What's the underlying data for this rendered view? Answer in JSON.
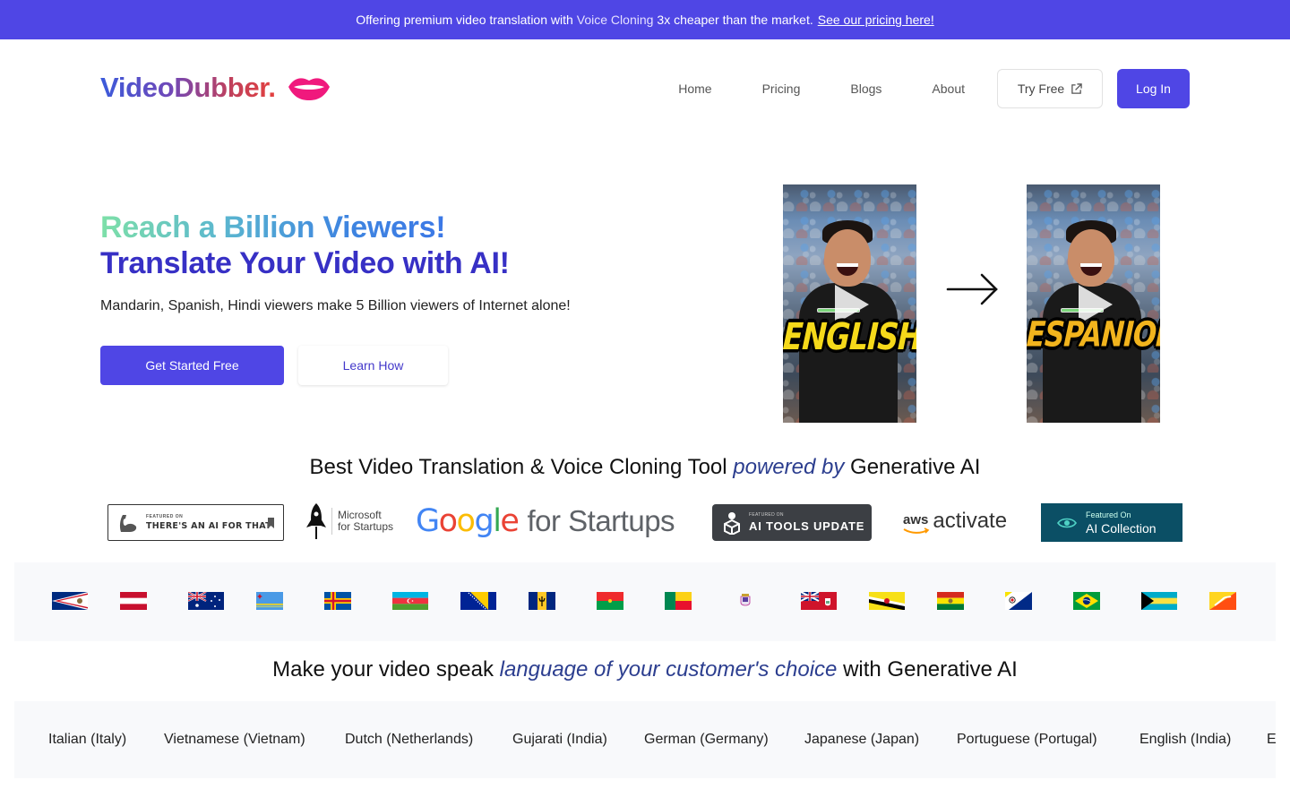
{
  "promo": {
    "text_before": "Offering premium video translation with",
    "highlight": "Voice Cloning",
    "text_after": "3x cheaper than the market.",
    "link": "See our pricing here!",
    "bg_color": "#4f46e5"
  },
  "header": {
    "logo": "VideoDubber.",
    "logo_icon": "lips-icon",
    "nav": [
      "Home",
      "Pricing",
      "Blogs",
      "About"
    ],
    "try_free": "Try Free",
    "try_free_icon": "external-link-icon",
    "login": "Log In"
  },
  "hero": {
    "title_line1": "Reach a Billion Viewers!",
    "title_line2": "Translate Your Video with AI!",
    "subtitle": "Mandarin, Spanish, Hindi viewers make 5 Billion viewers of Internet alone!",
    "cta_primary": "Get Started Free",
    "cta_secondary": "Learn How",
    "video_before_caption": "ENGLISH",
    "video_after_caption": "ESPANIOL",
    "arrow_icon": "arrow-right-icon"
  },
  "section_powered": {
    "before": "Best Video Translation & Voice Cloning Tool",
    "emphasis": "powered by",
    "after": "Generative AI"
  },
  "badges": {
    "taaft": {
      "small": "FEATURED ON",
      "big": "THERE'S AN AI FOR THAT"
    },
    "microsoft": {
      "line1": "Microsoft",
      "line2": "for Startups"
    },
    "google": {
      "brand": "Google",
      "suffix": "for Startups"
    },
    "aitools": {
      "small": "FEATURED ON",
      "big": "AI TOOLS UPDATE"
    },
    "aws": {
      "brand": "aws",
      "suffix": "activate"
    },
    "aicollection": {
      "small": "Featured On",
      "big": "AI Collection"
    }
  },
  "flags": [
    "American Samoa",
    "Austria",
    "Australia",
    "Aruba",
    "Aland Islands",
    "Azerbaijan",
    "Bosnia and Herzegovina",
    "Barbados",
    "Burkina Faso",
    "Benin",
    "Saint Barthelemy",
    "Bermuda",
    "Brunei",
    "Bolivia",
    "Bonaire",
    "Brazil",
    "Bahamas",
    "Bhutan"
  ],
  "section_language": {
    "before": "Make your video speak",
    "emphasis": "language of your customer's choice",
    "after": "with Generative AI"
  },
  "languages": [
    "Italian (Italy)",
    "Vietnamese (Vietnam)",
    "Dutch (Netherlands)",
    "Gujarati (India)",
    "German (Germany)",
    "Japanese (Japan)",
    "Portuguese (Portugal)",
    "English (India)",
    "E"
  ]
}
